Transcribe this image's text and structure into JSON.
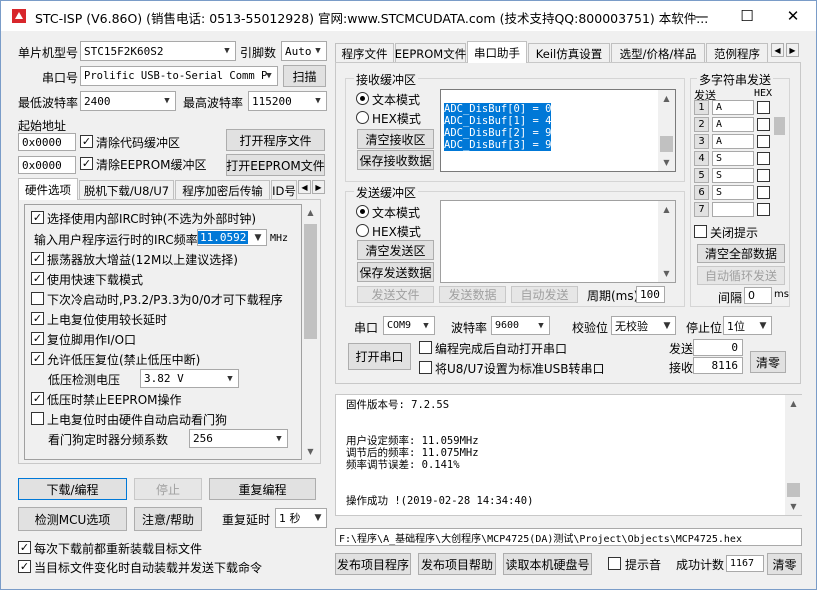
{
  "window": {
    "title": "STC-ISP (V6.86O) (销售电话: 0513-55012928) 官网:www.STCMCUDATA.com (技术支持QQ:800003751) 本软件...",
    "min": "—",
    "max": "☐",
    "close": "✕"
  },
  "left": {
    "mcu_label": "单片机型号",
    "mcu_value": "STC15F2K60S2",
    "pin_label": "引脚数",
    "pin_value": "Auto",
    "port_label": "串口号",
    "port_value": "Prolific USB-to-Serial Comm P",
    "scan_button": "扫描",
    "min_baud_label": "最低波特率",
    "min_baud_value": "2400",
    "max_baud_label": "最高波特率",
    "max_baud_value": "115200",
    "start_addr_label": "起始地址",
    "addr1": "0x0000",
    "clear_code": "清除代码缓冲区",
    "open_prog": "打开程序文件",
    "addr2": "0x0000",
    "clear_eeprom": "清除EEPROM缓冲区",
    "open_eeprom": "打开EEPROM文件",
    "tabs": [
      "硬件选项",
      "脱机下载/U8/U7",
      "程序加密后传输",
      "ID号"
    ],
    "options": [
      {
        "label": "选择使用内部IRC时钟(不选为外部时钟)",
        "checked": true
      },
      {
        "label": "振荡器放大增益(12M以上建议选择)",
        "checked": true
      },
      {
        "label": "使用快速下载模式",
        "checked": true
      },
      {
        "label": "下次冷启动时,P3.2/P3.3为0/0才可下载程序",
        "checked": false
      },
      {
        "label": "上电复位使用较长延时",
        "checked": true
      },
      {
        "label": "复位脚用作I/O口",
        "checked": true
      },
      {
        "label": "允许低压复位(禁止低压中断)",
        "checked": true
      },
      {
        "label": "低压时禁止EEPROM操作",
        "checked": true
      },
      {
        "label": "上电复位时由硬件自动启动看门狗",
        "checked": false
      }
    ],
    "irc_label": "输入用户程序运行时的IRC频率",
    "irc_value": "11.0592",
    "irc_unit": "MHz",
    "lowv_label": "低压检测电压",
    "lowv_value": "3.82 V",
    "wdt_label": "看门狗定时器分频系数",
    "wdt_value": "256",
    "download_button": "下载/编程",
    "stop_button": "停止",
    "reprogram_button": "重复编程",
    "detect_button": "检测MCU选项",
    "help_button": "注意/帮助",
    "delay_label": "重复延时",
    "delay_value": "1 秒",
    "reload_label": "每次下载前都重新装载目标文件",
    "reload_checked": true,
    "auto_label": "当目标文件变化时自动装载并发送下载命令",
    "auto_checked": true
  },
  "right": {
    "tabs": [
      "程序文件",
      "EEPROM文件",
      "串口助手",
      "Keil仿真设置",
      "选型/价格/样品",
      "范例程序"
    ],
    "recv_group": "接收缓冲区",
    "text_mode": "文本模式",
    "hex_mode": "HEX模式",
    "clear_recv": "清空接收区",
    "save_recv": "保存接收数据",
    "recv_lines": [
      "ADC_DisBuf[0] = 0",
      "ADC_DisBuf[1] = 4",
      "ADC_DisBuf[2] = 9",
      "ADC_DisBuf[3] = 9"
    ],
    "send_group": "发送缓冲区",
    "send_text_mode": "文本模式",
    "send_hex_mode": "HEX模式",
    "clear_send": "清空发送区",
    "save_send": "保存发送数据",
    "send_file": "发送文件",
    "send_data": "发送数据",
    "auto_send": "自动发送",
    "period_label": "周期(ms)",
    "period_value": "100",
    "multi_group": "多字符串发送",
    "col_send": "发送",
    "col_hex": "HEX",
    "multi_rows": [
      {
        "n": "1",
        "v": "A"
      },
      {
        "n": "2",
        "v": "A"
      },
      {
        "n": "3",
        "v": "A"
      },
      {
        "n": "4",
        "v": "S"
      },
      {
        "n": "5",
        "v": "S"
      },
      {
        "n": "6",
        "v": "S"
      },
      {
        "n": "7",
        "v": ""
      }
    ],
    "close_tip": "关闭提示",
    "clear_all": "清空全部数据",
    "auto_loop": "自动循环发送",
    "interval_label": "间隔",
    "interval_value": "0",
    "interval_unit": "ms",
    "com_label": "串口",
    "com_value": "COM9",
    "baud_label": "波特率",
    "baud_value": "9600",
    "parity_label": "校验位",
    "parity_value": "无校验",
    "stop_label": "停止位",
    "stop_value": "1位",
    "open_port": "打开串口",
    "opt1": "编程完成后自动打开串口",
    "opt2": "将U8/U7设置为标准USB转串口",
    "sent_label": "发送",
    "sent_value": "0",
    "recv_label": "接收",
    "recv_value": "8116",
    "clear_count": "清零",
    "log_lines": [
      "固件版本号: 7.2.5S",
      "",
      "",
      "用户设定频率: 11.059MHz",
      "调节后的频率: 11.075MHz",
      "频率调节误差: 0.141%",
      "",
      "",
      "操作成功 !(2019-02-28 14:34:40)"
    ],
    "path": "F:\\程序\\A_基础程序\\大创程序\\MCP4725(DA)测试\\Project\\Objects\\MCP4725.hex",
    "publish": "发布项目程序",
    "publish_help": "发布项目帮助",
    "read_disk": "读取本机硬盘号",
    "beep": "提示音",
    "count_label": "成功计数",
    "count_value": "1167",
    "count_clear": "清零"
  },
  "colors": {
    "selection": "#0078d7",
    "button": "#e1e1e1",
    "window_bg": "#f0f0f0"
  }
}
